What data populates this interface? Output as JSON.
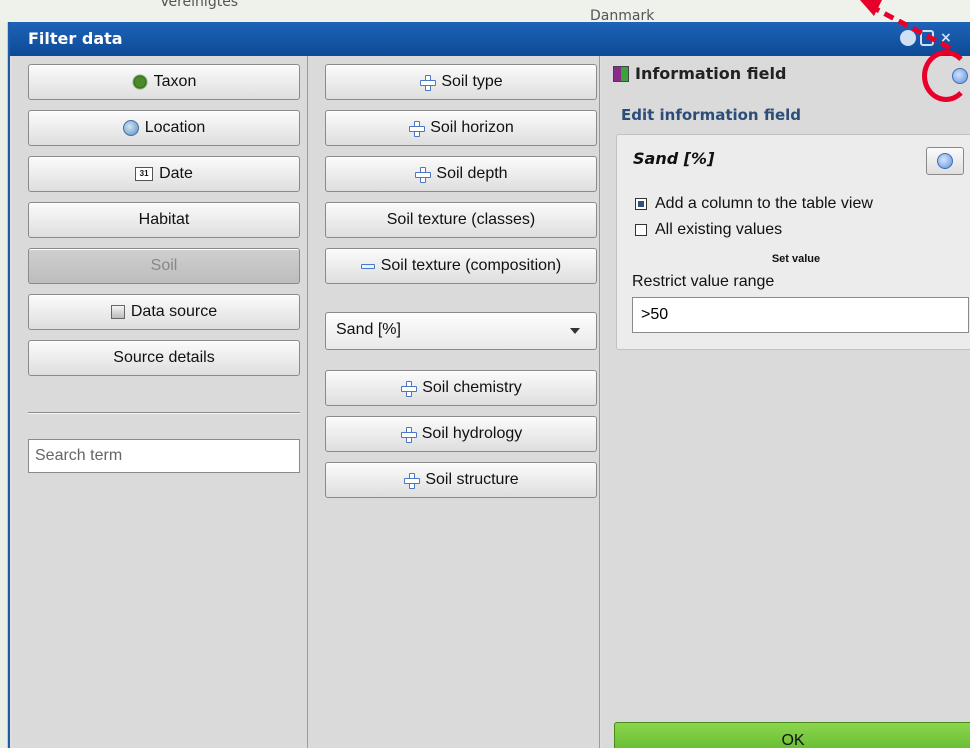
{
  "map": {
    "label_left": "Vereinigtes",
    "label_right": "Danmark"
  },
  "dialog": {
    "title": "Filter data"
  },
  "left_column": {
    "buttons": [
      {
        "label": "Taxon",
        "icon": "taxon-icon"
      },
      {
        "label": "Location",
        "icon": "globe-icon"
      },
      {
        "label": "Date",
        "icon": "calendar-icon"
      },
      {
        "label": "Habitat",
        "icon": ""
      },
      {
        "label": "Soil",
        "icon": "",
        "state": "disabled"
      },
      {
        "label": "Data source",
        "icon": "document-icon"
      },
      {
        "label": "Source details",
        "icon": ""
      }
    ],
    "search": {
      "placeholder": "Search term",
      "value": ""
    }
  },
  "middle_column": {
    "buttons": [
      {
        "label": "Soil type",
        "icon": "plus-icon"
      },
      {
        "label": "Soil horizon",
        "icon": "plus-icon"
      },
      {
        "label": "Soil depth",
        "icon": "plus-icon"
      },
      {
        "label": "Soil texture (classes)",
        "icon": ""
      },
      {
        "label": "Soil texture (composition)",
        "icon": "minus-icon"
      },
      {
        "label": "Soil chemistry",
        "icon": "plus-icon"
      },
      {
        "label": "Soil hydrology",
        "icon": "plus-icon"
      },
      {
        "label": "Soil structure",
        "icon": "plus-icon"
      }
    ],
    "select": {
      "value": "Sand [%]"
    }
  },
  "info_panel": {
    "heading": "Information field",
    "edit_heading": "Edit information field",
    "field_title": "Sand [%]",
    "checkboxes": [
      {
        "label": "Add a column to the table view",
        "checked": true
      },
      {
        "label": "All existing values",
        "checked": false
      }
    ],
    "set_value_label": "Set value",
    "restrict_label": "Restrict value range",
    "restrict_value": ">50",
    "ok_label": "OK"
  },
  "colors": {
    "titlebar": "#1a5aaa",
    "ok_green": "#6cc236",
    "annotation_red": "#e8002a"
  }
}
